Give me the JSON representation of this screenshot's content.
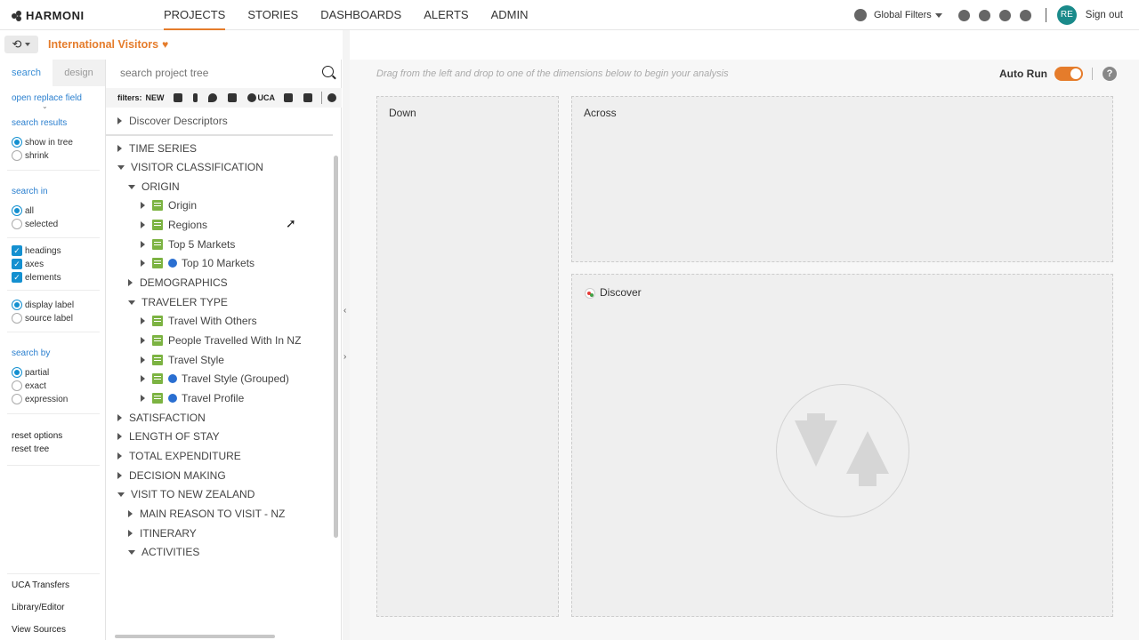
{
  "app": {
    "logo": "HARMONI"
  },
  "nav": {
    "tabs": [
      "PROJECTS",
      "STORIES",
      "DASHBOARDS",
      "ALERTS",
      "ADMIN"
    ],
    "active": "PROJECTS"
  },
  "header_right": {
    "global_filters": "Global Filters",
    "avatar_initials": "RE",
    "sign_out": "Sign out"
  },
  "breadcrumb": {
    "project": "International Visitors"
  },
  "options": {
    "tabs": [
      "search",
      "design"
    ],
    "open_replace": "open replace field",
    "search_results": "search results",
    "show_in_tree": "show in tree",
    "shrink": "shrink",
    "search_in": "search in",
    "all": "all",
    "selected": "selected",
    "headings": "headings",
    "axes": "axes",
    "elements": "elements",
    "display_label": "display label",
    "source_label": "source label",
    "search_by": "search by",
    "partial": "partial",
    "exact": "exact",
    "expression": "expression",
    "reset_options": "reset options",
    "reset_tree": "reset tree",
    "uca_transfers": "UCA Transfers",
    "library_editor": "Library/Editor",
    "view_sources": "View Sources"
  },
  "tree": {
    "search_placeholder": "search project tree",
    "filters_label": "filters:",
    "new_label": "NEW",
    "uca_label": "UCA",
    "discover": "Discover Descriptors",
    "items": [
      {
        "label": "TIME SERIES"
      },
      {
        "label": "VISITOR CLASSIFICATION"
      },
      {
        "label": "ORIGIN"
      },
      {
        "label": "Origin"
      },
      {
        "label": "Regions"
      },
      {
        "label": "Top 5 Markets"
      },
      {
        "label": "Top 10 Markets"
      },
      {
        "label": "DEMOGRAPHICS"
      },
      {
        "label": "TRAVELER TYPE"
      },
      {
        "label": "Travel With Others"
      },
      {
        "label": "People Travelled With In NZ"
      },
      {
        "label": "Travel Style"
      },
      {
        "label": "Travel Style (Grouped)"
      },
      {
        "label": "Travel Profile"
      },
      {
        "label": "SATISFACTION"
      },
      {
        "label": "LENGTH OF STAY"
      },
      {
        "label": "TOTAL EXPENDITURE"
      },
      {
        "label": "DECISION MAKING"
      },
      {
        "label": "VISIT TO NEW ZEALAND"
      },
      {
        "label": "MAIN REASON TO VISIT - NZ"
      },
      {
        "label": "ITINERARY"
      },
      {
        "label": "ACTIVITIES"
      }
    ]
  },
  "canvas": {
    "hint": "Drag from the left and drop to one of the dimensions below to begin your analysis",
    "auto_run": "Auto Run",
    "down": "Down",
    "across": "Across",
    "discover": "Discover"
  },
  "colors": {
    "accent": "#e57c2b",
    "link": "#2a7fcf",
    "element_icon": "#7cb342"
  }
}
